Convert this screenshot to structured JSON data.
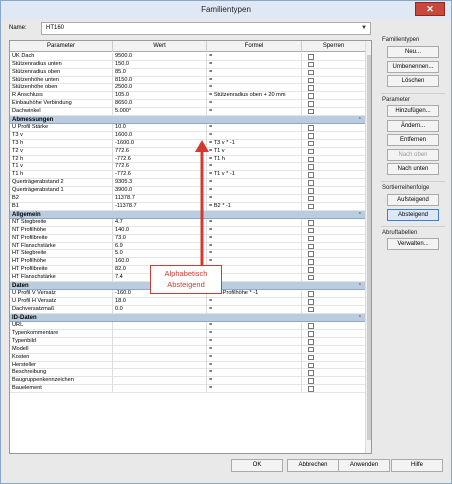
{
  "window": {
    "title": "Familientypen",
    "close_glyph": "✕"
  },
  "name": {
    "label": "Name:",
    "value": "HT160"
  },
  "columns": [
    "Parameter",
    "Wert",
    "Formel",
    "Sperren"
  ],
  "rows": [
    {
      "type": "row",
      "param": "UK Dach",
      "wert": "9500.0",
      "formel": "="
    },
    {
      "type": "row",
      "param": "Stützenradius unten",
      "wert": "150.0",
      "formel": "="
    },
    {
      "type": "row",
      "param": "Stützenradius oben",
      "wert": "85.0",
      "formel": "="
    },
    {
      "type": "row",
      "param": "Stützenhöhe unten",
      "wert": "8150.0",
      "formel": "="
    },
    {
      "type": "row",
      "param": "Stützenhöhe oben",
      "wert": "2500.0",
      "formel": "="
    },
    {
      "type": "row",
      "param": "R Anschluss",
      "wert": "105.0",
      "formel": "= Stützenradius oben + 20 mm"
    },
    {
      "type": "row",
      "param": "Einbauhöhe Verbindung",
      "wert": "8650.0",
      "formel": "="
    },
    {
      "type": "row",
      "param": "Dachwinkel",
      "wert": "5.000°",
      "formel": "="
    },
    {
      "type": "group",
      "label": "Abmessungen"
    },
    {
      "type": "row",
      "param": "U Profil Stärke",
      "wert": "10.0",
      "formel": "="
    },
    {
      "type": "row",
      "param": "T3 v",
      "wert": "1600.0",
      "formel": "="
    },
    {
      "type": "row",
      "param": "T3 h",
      "wert": "-1600.0",
      "formel": "= T3 v * -1"
    },
    {
      "type": "row",
      "param": "T2 v",
      "wert": "772.6",
      "formel": "= T1 v"
    },
    {
      "type": "row",
      "param": "T2 h",
      "wert": "-772.6",
      "formel": "= T1 h"
    },
    {
      "type": "row",
      "param": "T1 v",
      "wert": "772.6",
      "formel": "="
    },
    {
      "type": "row",
      "param": "T1 h",
      "wert": "-772.6",
      "formel": "= T1 v * -1"
    },
    {
      "type": "row",
      "param": "Querträgerabstand 2",
      "wert": "9305.3",
      "formel": "="
    },
    {
      "type": "row",
      "param": "Querträgerabstand 1",
      "wert": "3900.0",
      "formel": "="
    },
    {
      "type": "row",
      "param": "B2",
      "wert": "11378.7",
      "formel": "="
    },
    {
      "type": "row",
      "param": "B1",
      "wert": "-11378.7",
      "formel": "= B2 * -1"
    },
    {
      "type": "group",
      "label": "Allgemein"
    },
    {
      "type": "row",
      "param": "NT Stegbreite",
      "wert": "4.7",
      "formel": "="
    },
    {
      "type": "row",
      "param": "NT Profilhöhe",
      "wert": "140.0",
      "formel": "="
    },
    {
      "type": "row",
      "param": "NT Profilbreite",
      "wert": "73.0",
      "formel": "="
    },
    {
      "type": "row",
      "param": "NT Flanschstärke",
      "wert": "6.9",
      "formel": "="
    },
    {
      "type": "row",
      "param": "HT Stegbreite",
      "wert": "5.0",
      "formel": "="
    },
    {
      "type": "row",
      "param": "HT Profilhöhe",
      "wert": "160.0",
      "formel": "="
    },
    {
      "type": "row",
      "param": "HT Profilbreite",
      "wert": "82.0",
      "formel": "="
    },
    {
      "type": "row",
      "param": "HT Flanschstärke",
      "wert": "7.4",
      "formel": "="
    },
    {
      "type": "group",
      "label": "Daten"
    },
    {
      "type": "row",
      "param": "U Profil V Versatz",
      "wert": "-160.0",
      "formel": "= HT Profilhöhe * -1"
    },
    {
      "type": "row",
      "param": "U Profil H Versatz",
      "wert": "18.0",
      "formel": "="
    },
    {
      "type": "row",
      "param": "Dachversatzmaß",
      "wert": "0.0",
      "formel": "="
    },
    {
      "type": "group",
      "label": "ID-Daten"
    },
    {
      "type": "row",
      "param": "URL",
      "wert": "",
      "formel": "="
    },
    {
      "type": "row",
      "param": "Typenkommentare",
      "wert": "",
      "formel": "="
    },
    {
      "type": "row",
      "param": "Typenbild",
      "wert": "",
      "formel": "="
    },
    {
      "type": "row",
      "param": "Modell",
      "wert": "",
      "formel": "="
    },
    {
      "type": "row",
      "param": "Kosten",
      "wert": "",
      "formel": "="
    },
    {
      "type": "row",
      "param": "Hersteller",
      "wert": "",
      "formel": "="
    },
    {
      "type": "row",
      "param": "Beschreibung",
      "wert": "",
      "formel": "="
    },
    {
      "type": "row",
      "param": "Baugruppenkennzeichen",
      "wert": "",
      "formel": "="
    },
    {
      "type": "row",
      "param": "Bauelement",
      "wert": "",
      "formel": "="
    }
  ],
  "side": {
    "familientypen_label": "Familientypen",
    "neu": "Neu...",
    "umbenennen": "Umbenennen...",
    "loeschen": "Löschen",
    "parameter_label": "Parameter",
    "hinzufuegen": "Hinzufügen...",
    "aendern": "Ändern...",
    "entfernen": "Entfernen",
    "nach_oben": "Nach oben",
    "nach_unten": "Nach unten",
    "sort_label": "Sortierreihenfolge",
    "aufsteigend": "Aufsteigend",
    "absteigend": "Absteigend",
    "abruf_label": "Abruftabellen",
    "verwalten": "Verwalten..."
  },
  "bottom": {
    "ok": "OK",
    "abbrechen": "Abbrechen",
    "anwenden": "Anwenden",
    "hilfe": "Hilfe"
  },
  "annotation": {
    "line1": "Alphabetisch",
    "line2": "Absteigend"
  },
  "icons": {
    "close": "close-icon",
    "dropdown": "chevron-down-icon",
    "collapse": "collapse-icon",
    "arrow": "up-arrow-icon"
  },
  "colors": {
    "accent": "#d13a30",
    "group_bg": "#b9cce0",
    "close_bg": "#c9483d"
  }
}
